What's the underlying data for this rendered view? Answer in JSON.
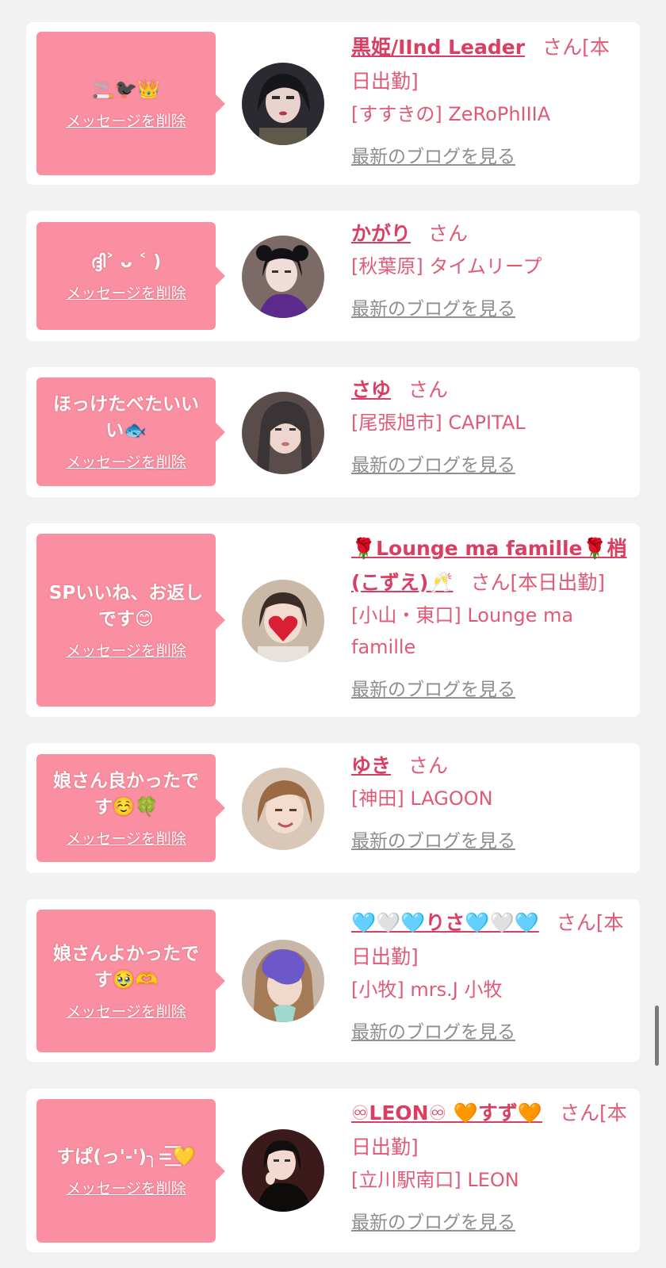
{
  "delete_label": "メッセージを削除",
  "blog_label": "最新のブログを見る",
  "colors": {
    "bubble": "#fb8fa2",
    "accent": "#d83f62",
    "text": "#e05a78",
    "link_gray": "#8e8e8e",
    "background": "#f2f2f2"
  },
  "items": [
    {
      "message": "🚬🐦‍⬛👑",
      "name": "黒姫/IInd Leader",
      "suffix": "さん[本日出勤]",
      "shop": "[すすきの] ZeRoPhIIIA",
      "avatar": "dark-haired-woman-avatar"
    },
    {
      "message": "ദ്ദി˃ ᴗ ˂ )",
      "name": "かがり",
      "suffix": "さん",
      "shop": "[秋葉原] タイムリープ",
      "avatar": "twin-tail-woman-avatar"
    },
    {
      "message": "ほっけたべたいいい🐟",
      "name": "さゆ",
      "suffix": "さん",
      "shop": "[尾張旭市] CAPITAL",
      "avatar": "long-hair-woman-avatar"
    },
    {
      "message": "SPいいね、お返しです😊",
      "name": "🌹Lounge ma famille🌹梢(こずえ)🥂",
      "suffix": "さん[本日出勤]",
      "shop": "[小山・東口] Lounge ma famille",
      "avatar": "heart-sticker-woman-avatar"
    },
    {
      "message": "娘さん良かったです☺️🍀",
      "name": "ゆき",
      "suffix": "さん",
      "shop": "[神田] LAGOON",
      "avatar": "brown-hair-woman-avatar"
    },
    {
      "message": "娘さんよかったです🥹🫶",
      "name": "🩵🤍🩵りさ🩵🤍🩵",
      "suffix": "さん[本日出勤]",
      "shop": "[小牧] mrs.J 小牧",
      "avatar": "purple-sticker-woman-avatar"
    },
    {
      "message": "すぱ(っ'-')╮=͟͟͞͞💛",
      "name": "♾LEON♾ 🧡すず🧡",
      "suffix": "さん[本日出勤]",
      "shop": "[立川駅南口] LEON",
      "avatar": "black-dress-woman-avatar"
    }
  ]
}
